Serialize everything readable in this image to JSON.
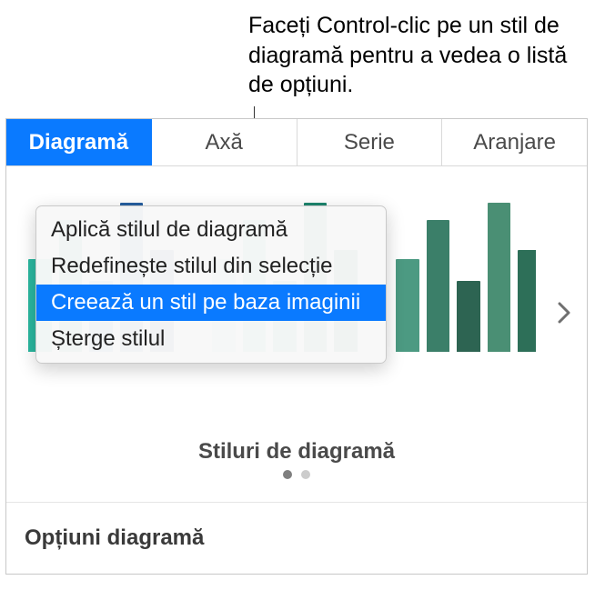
{
  "annotation": "Faceți Control-clic pe un stil de diagramă pentru a vedea o listă de opțiuni.",
  "tabs": {
    "diagram": "Diagramă",
    "axis": "Axă",
    "series": "Serie",
    "arrange": "Aranjare"
  },
  "styles_section": {
    "title": "Stiluri de diagramă"
  },
  "context_menu": {
    "apply": "Aplică stilul de diagramă",
    "redefine": "Redefinește stilul din selecție",
    "create": "Creează un stil pe baza imaginii",
    "delete": "Șterge stilul"
  },
  "options_label": "Opțiuni diagramă",
  "thumb_colors": {
    "a": [
      "#2ab8a0",
      "#1ea58a",
      "#2f8dbd",
      "#265fa0",
      "#1f3f7a"
    ],
    "b": [
      "#8fd6c8",
      "#4dc0a8",
      "#2aa28a",
      "#1d856e",
      "#0f6a55"
    ],
    "c": [
      "#4c9a82",
      "#3b7f69",
      "#2d6452",
      "#4a8f74",
      "#2d6f58"
    ]
  }
}
